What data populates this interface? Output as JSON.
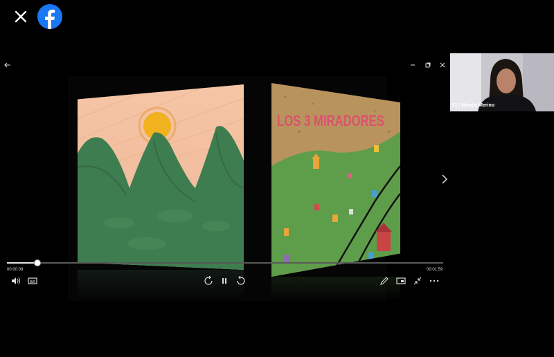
{
  "topbar": {
    "close_icon": "close-icon",
    "logo_icon": "facebook-logo-icon",
    "logo_color": "#1877f2"
  },
  "player": {
    "window_controls": [
      "back-arrow-icon",
      "minimize-icon",
      "restore-icon",
      "close-icon"
    ],
    "elapsed": "00:00:08",
    "duration": "00:01:59",
    "progress": 0.07,
    "controls_left": [
      "volume-icon",
      "captions-icon"
    ],
    "controls_center": [
      "rewind-icon",
      "pause-icon",
      "forward-icon"
    ],
    "controls_right": [
      "pen-icon",
      "screen-icon",
      "collapse-icon",
      "more-icon"
    ],
    "next_icon": "chevron-right-icon"
  },
  "video": {
    "left_scene": "mountains-with-sun",
    "right_scene_title": "LOS 3 MIRADORES",
    "sky_color": "#f1c2a3",
    "mountain_color": "#3e7d4f",
    "hill_color": "#5e9d4a"
  },
  "participant": {
    "label": "S1 / Wendy Merino"
  }
}
